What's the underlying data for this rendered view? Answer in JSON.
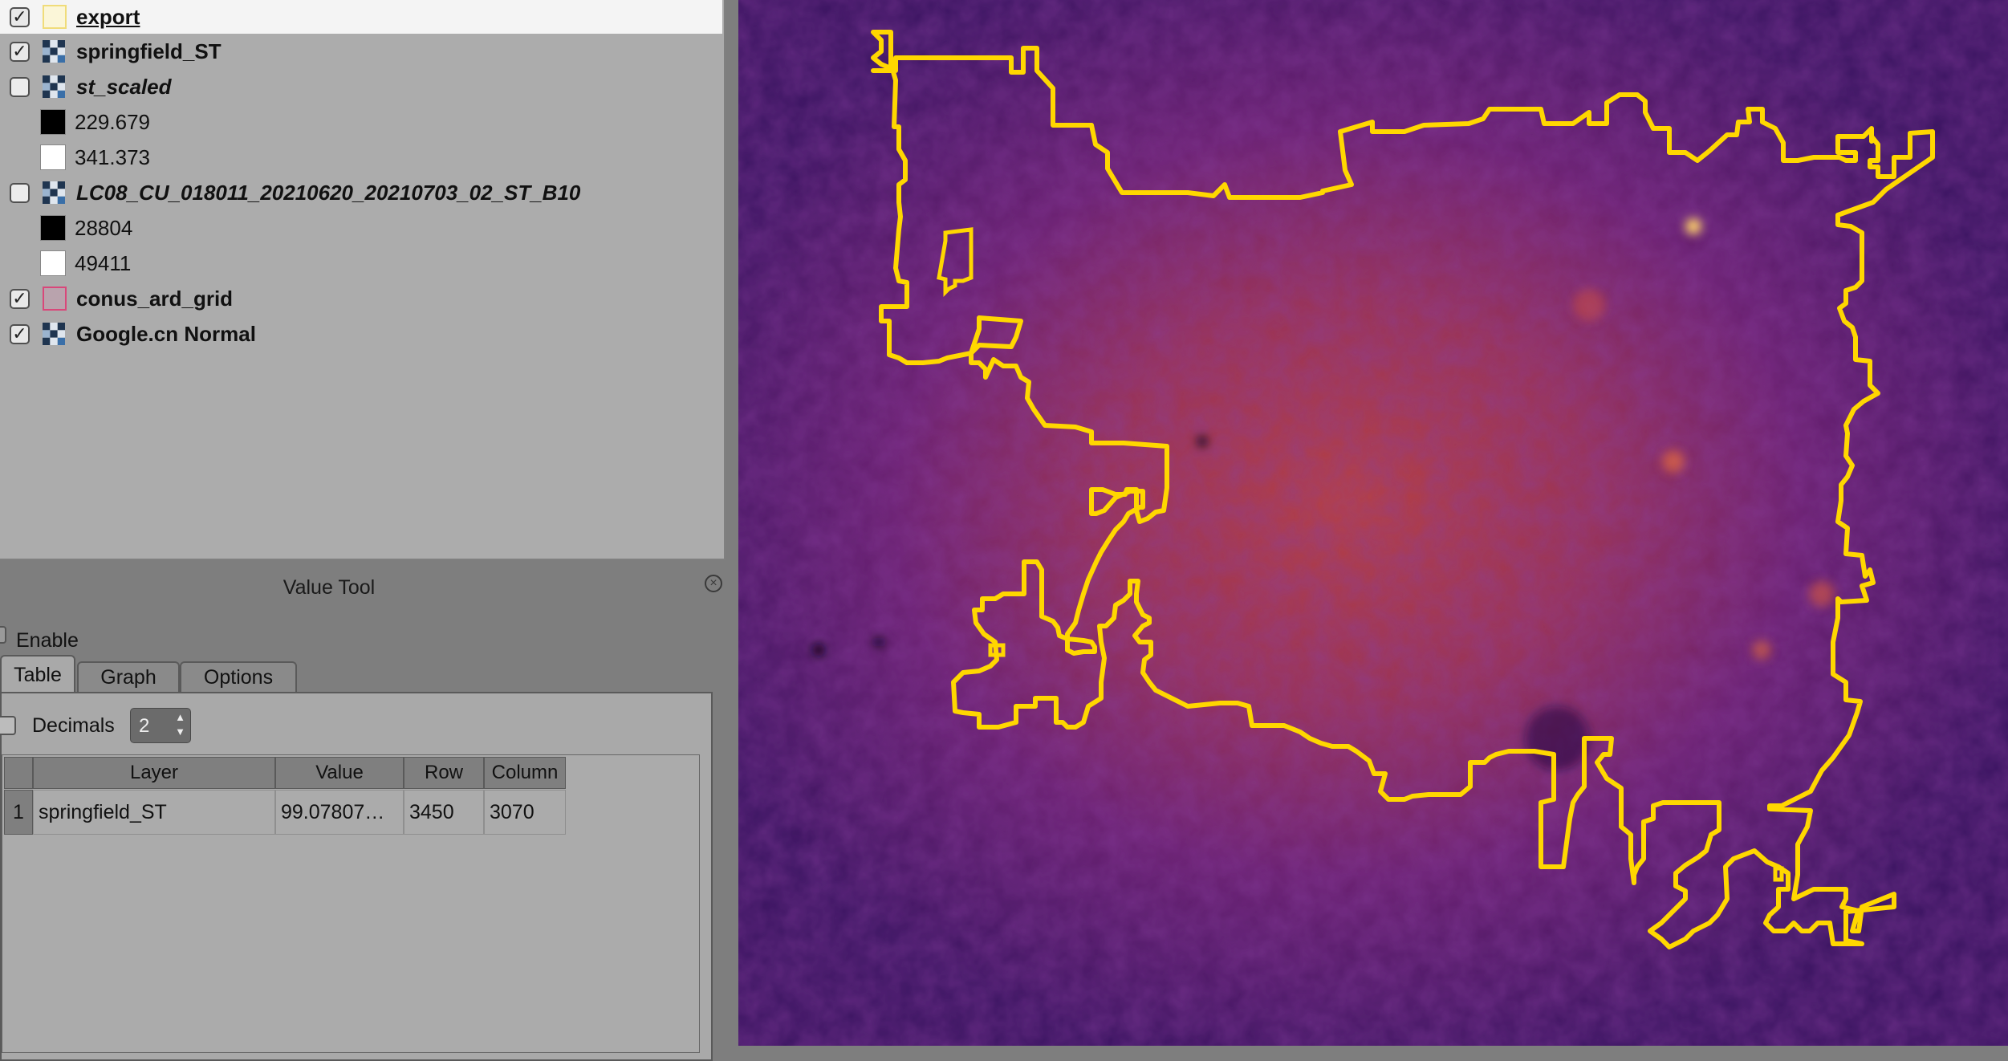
{
  "layers_panel": {
    "layers": [
      {
        "name": "export",
        "checked": true,
        "kind": "vector",
        "style": "underline",
        "selected": true,
        "icon": "vector-polygon-icon",
        "color": "#f2dc6a"
      },
      {
        "name": "springfield_ST",
        "checked": true,
        "kind": "raster",
        "style": "bold",
        "icon": "raster-icon"
      },
      {
        "name": "st_scaled",
        "checked": false,
        "kind": "raster",
        "style": "italic",
        "icon": "raster-icon"
      },
      {
        "legend": "229.679",
        "color": "#000000"
      },
      {
        "legend": "341.373",
        "color": "#ffffff"
      },
      {
        "name": "LC08_CU_018011_20210620_20210703_02_ST_B10",
        "checked": false,
        "kind": "raster",
        "style": "italic",
        "icon": "raster-icon"
      },
      {
        "legend": "28804",
        "color": "#000000"
      },
      {
        "legend": "49411",
        "color": "#ffffff"
      },
      {
        "name": "conus_ard_grid",
        "checked": true,
        "kind": "vector",
        "style": "bold",
        "icon": "vector-polygon-icon",
        "color": "#d9477a"
      },
      {
        "name": "Google.cn Normal",
        "checked": true,
        "kind": "raster",
        "style": "bold",
        "icon": "raster-icon"
      }
    ]
  },
  "value_tool": {
    "title": "Value Tool",
    "enable_label": "Enable",
    "tabs": [
      "Table",
      "Graph",
      "Options"
    ],
    "active_tab": "Table",
    "decimals_label": "Decimals",
    "decimals_value": "2",
    "table": {
      "columns": [
        "Layer",
        "Value",
        "Row",
        "Column"
      ],
      "rows": [
        {
          "index": "1",
          "layer": "springfield_ST",
          "value": "99.07807…",
          "row": "3450",
          "column": "3070"
        }
      ]
    }
  },
  "map": {
    "colormap": "inferno",
    "boundary_color": "#ffd700",
    "background_color": "#3a1460"
  }
}
